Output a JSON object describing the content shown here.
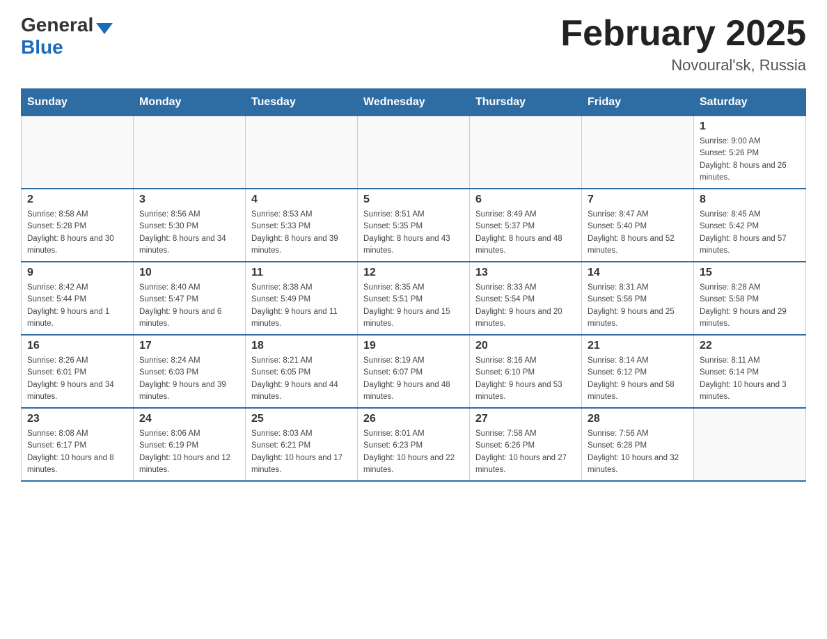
{
  "header": {
    "logo_general": "General",
    "logo_blue": "Blue",
    "title": "February 2025",
    "subtitle": "Novoural'sk, Russia"
  },
  "weekdays": [
    "Sunday",
    "Monday",
    "Tuesday",
    "Wednesday",
    "Thursday",
    "Friday",
    "Saturday"
  ],
  "weeks": [
    [
      {
        "day": "",
        "info": ""
      },
      {
        "day": "",
        "info": ""
      },
      {
        "day": "",
        "info": ""
      },
      {
        "day": "",
        "info": ""
      },
      {
        "day": "",
        "info": ""
      },
      {
        "day": "",
        "info": ""
      },
      {
        "day": "1",
        "info": "Sunrise: 9:00 AM\nSunset: 5:26 PM\nDaylight: 8 hours and 26 minutes."
      }
    ],
    [
      {
        "day": "2",
        "info": "Sunrise: 8:58 AM\nSunset: 5:28 PM\nDaylight: 8 hours and 30 minutes."
      },
      {
        "day": "3",
        "info": "Sunrise: 8:56 AM\nSunset: 5:30 PM\nDaylight: 8 hours and 34 minutes."
      },
      {
        "day": "4",
        "info": "Sunrise: 8:53 AM\nSunset: 5:33 PM\nDaylight: 8 hours and 39 minutes."
      },
      {
        "day": "5",
        "info": "Sunrise: 8:51 AM\nSunset: 5:35 PM\nDaylight: 8 hours and 43 minutes."
      },
      {
        "day": "6",
        "info": "Sunrise: 8:49 AM\nSunset: 5:37 PM\nDaylight: 8 hours and 48 minutes."
      },
      {
        "day": "7",
        "info": "Sunrise: 8:47 AM\nSunset: 5:40 PM\nDaylight: 8 hours and 52 minutes."
      },
      {
        "day": "8",
        "info": "Sunrise: 8:45 AM\nSunset: 5:42 PM\nDaylight: 8 hours and 57 minutes."
      }
    ],
    [
      {
        "day": "9",
        "info": "Sunrise: 8:42 AM\nSunset: 5:44 PM\nDaylight: 9 hours and 1 minute."
      },
      {
        "day": "10",
        "info": "Sunrise: 8:40 AM\nSunset: 5:47 PM\nDaylight: 9 hours and 6 minutes."
      },
      {
        "day": "11",
        "info": "Sunrise: 8:38 AM\nSunset: 5:49 PM\nDaylight: 9 hours and 11 minutes."
      },
      {
        "day": "12",
        "info": "Sunrise: 8:35 AM\nSunset: 5:51 PM\nDaylight: 9 hours and 15 minutes."
      },
      {
        "day": "13",
        "info": "Sunrise: 8:33 AM\nSunset: 5:54 PM\nDaylight: 9 hours and 20 minutes."
      },
      {
        "day": "14",
        "info": "Sunrise: 8:31 AM\nSunset: 5:56 PM\nDaylight: 9 hours and 25 minutes."
      },
      {
        "day": "15",
        "info": "Sunrise: 8:28 AM\nSunset: 5:58 PM\nDaylight: 9 hours and 29 minutes."
      }
    ],
    [
      {
        "day": "16",
        "info": "Sunrise: 8:26 AM\nSunset: 6:01 PM\nDaylight: 9 hours and 34 minutes."
      },
      {
        "day": "17",
        "info": "Sunrise: 8:24 AM\nSunset: 6:03 PM\nDaylight: 9 hours and 39 minutes."
      },
      {
        "day": "18",
        "info": "Sunrise: 8:21 AM\nSunset: 6:05 PM\nDaylight: 9 hours and 44 minutes."
      },
      {
        "day": "19",
        "info": "Sunrise: 8:19 AM\nSunset: 6:07 PM\nDaylight: 9 hours and 48 minutes."
      },
      {
        "day": "20",
        "info": "Sunrise: 8:16 AM\nSunset: 6:10 PM\nDaylight: 9 hours and 53 minutes."
      },
      {
        "day": "21",
        "info": "Sunrise: 8:14 AM\nSunset: 6:12 PM\nDaylight: 9 hours and 58 minutes."
      },
      {
        "day": "22",
        "info": "Sunrise: 8:11 AM\nSunset: 6:14 PM\nDaylight: 10 hours and 3 minutes."
      }
    ],
    [
      {
        "day": "23",
        "info": "Sunrise: 8:08 AM\nSunset: 6:17 PM\nDaylight: 10 hours and 8 minutes."
      },
      {
        "day": "24",
        "info": "Sunrise: 8:06 AM\nSunset: 6:19 PM\nDaylight: 10 hours and 12 minutes."
      },
      {
        "day": "25",
        "info": "Sunrise: 8:03 AM\nSunset: 6:21 PM\nDaylight: 10 hours and 17 minutes."
      },
      {
        "day": "26",
        "info": "Sunrise: 8:01 AM\nSunset: 6:23 PM\nDaylight: 10 hours and 22 minutes."
      },
      {
        "day": "27",
        "info": "Sunrise: 7:58 AM\nSunset: 6:26 PM\nDaylight: 10 hours and 27 minutes."
      },
      {
        "day": "28",
        "info": "Sunrise: 7:56 AM\nSunset: 6:28 PM\nDaylight: 10 hours and 32 minutes."
      },
      {
        "day": "",
        "info": ""
      }
    ]
  ]
}
